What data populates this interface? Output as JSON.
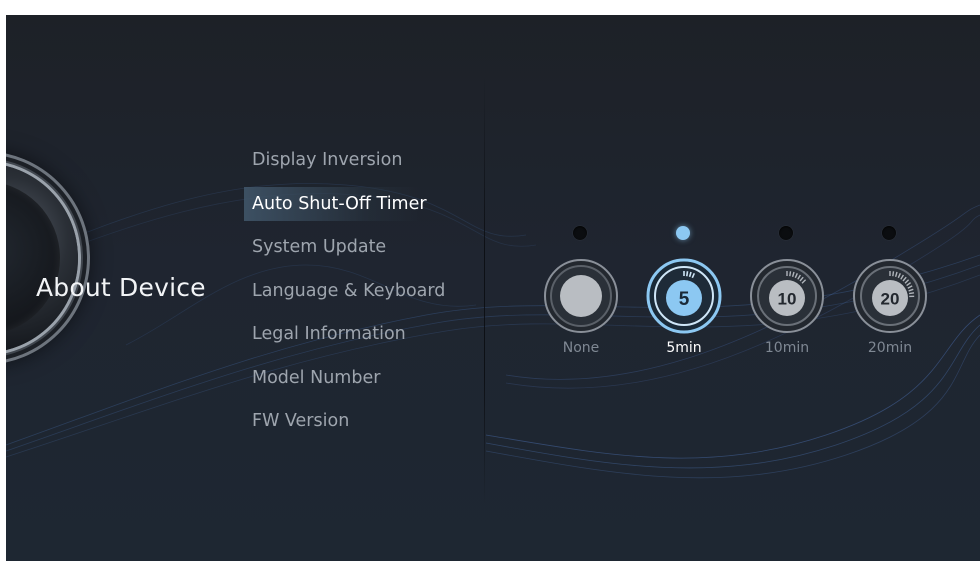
{
  "panel": {
    "title": "About Device"
  },
  "menu": {
    "selected_index": 1,
    "items": [
      {
        "label": "Display Inversion"
      },
      {
        "label": "Auto Shut-Off Timer"
      },
      {
        "label": "System Update"
      },
      {
        "label": "Language & Keyboard"
      },
      {
        "label": "Legal Information"
      },
      {
        "label": "Model Number"
      },
      {
        "label": "FW Version"
      }
    ]
  },
  "timer": {
    "selected_index": 1,
    "options": [
      {
        "label": "None",
        "icon": "none-timer-icon"
      },
      {
        "label": "5min",
        "icon": "timer-5-icon",
        "number": "5"
      },
      {
        "label": "10min",
        "icon": "timer-10-icon",
        "number": "10"
      },
      {
        "label": "20min",
        "icon": "timer-20-icon",
        "number": "20"
      }
    ]
  },
  "colors": {
    "background": "#1f2530",
    "accent": "#8cc8f2",
    "text_active": "#ffffff",
    "text_inactive": "#9ea5ae"
  }
}
